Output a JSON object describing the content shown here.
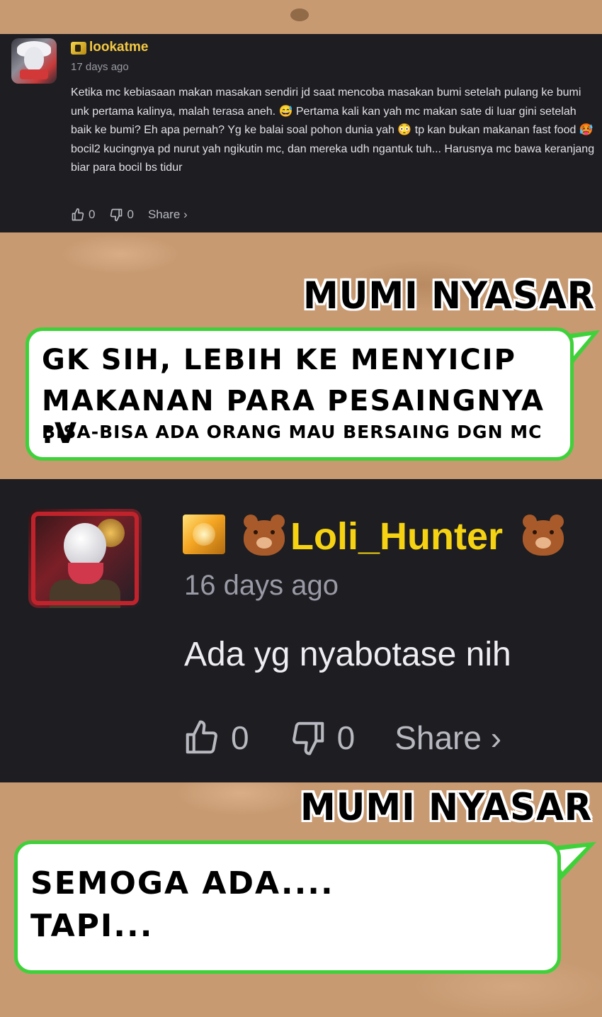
{
  "comment1": {
    "username": "lookatme",
    "time": "17 days ago",
    "body": "Ketika mc kebiasaan makan masakan sendiri jd saat mencoba masakan bumi setelah pulang ke bumi unk pertama kalinya, malah terasa aneh. 😅 Pertama kali kan yah mc makan sate di luar gini setelah baik ke bumi? Eh apa pernah? Yg ke balai soal pohon dunia yah 😳 tp kan bukan makanan fast food 🥵 bocil2 kucingnya pd nurut yah ngikutin mc, dan mereka udh ngantuk tuh... Harusnya mc bawa keranjang biar para bocil bs tidur",
    "likes": "0",
    "dislikes": "0",
    "share_label": "Share ›"
  },
  "bubble1": {
    "speaker": "MUMI NYASAR",
    "line1": "GK SIH, LEBIH KE MENYICIP",
    "line2": "MAKANAN PARA PESAINGNYA :V",
    "line3": "BISA-BISA ADA ORANG MAU BERSAING DGN MC"
  },
  "comment2": {
    "username": "Loli_Hunter",
    "time": "16 days ago",
    "body": "Ada yg nyabotase nih",
    "likes": "0",
    "dislikes": "0",
    "share_label": "Share ›"
  },
  "bubble2": {
    "speaker": "MUMI NYASAR",
    "line1": "SEMOGA ADA....",
    "line2": "TAPI..."
  },
  "colors": {
    "panel_bg": "#1d1d22",
    "username1": "#f5c843",
    "username2": "#f5d313",
    "bubble_border": "#3fd13a",
    "muted_text": "#9a9aa3"
  }
}
